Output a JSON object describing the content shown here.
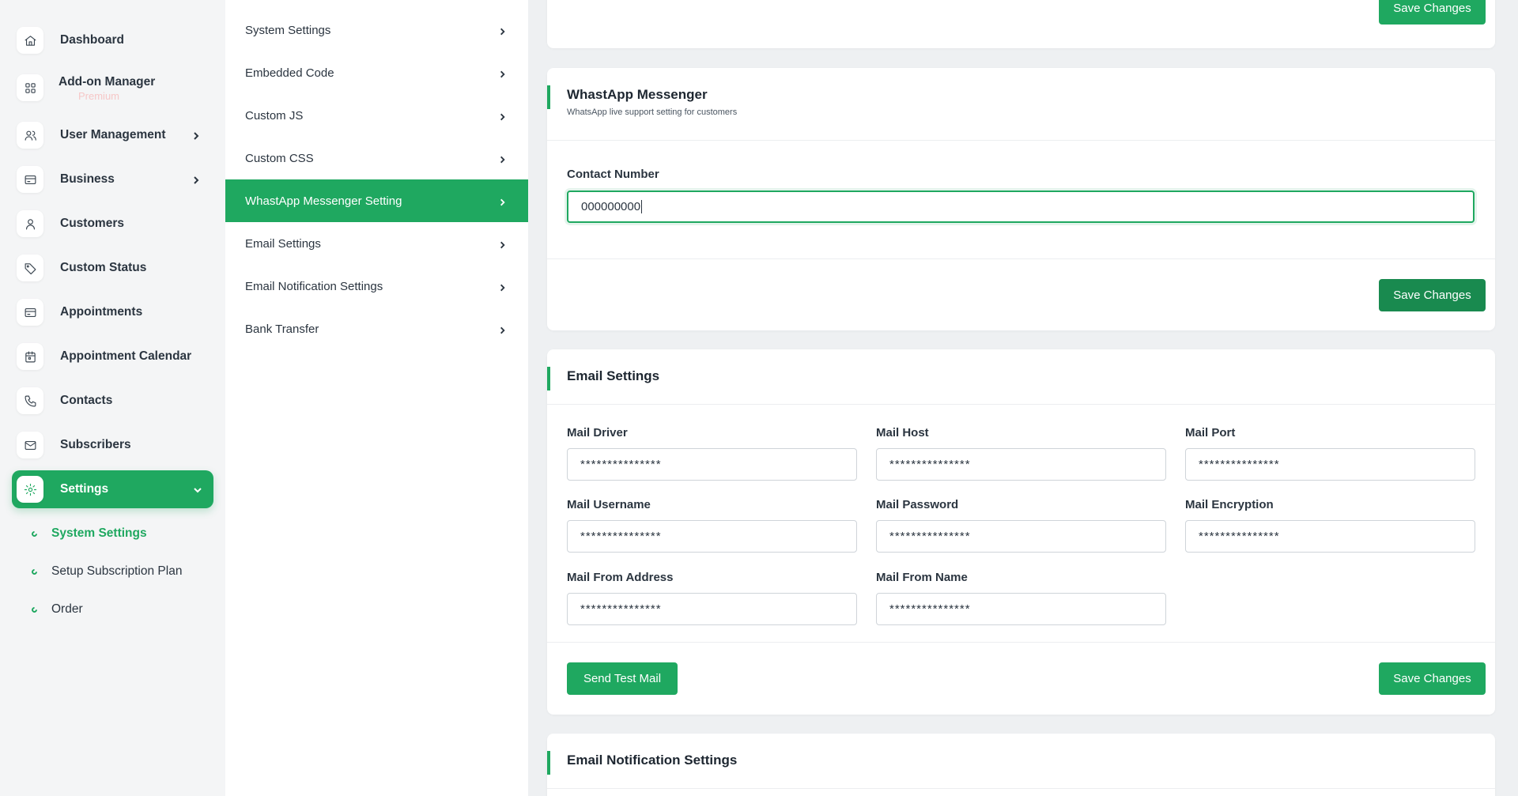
{
  "sidebar": {
    "items": [
      {
        "label": "Dashboard",
        "icon": "home-icon"
      },
      {
        "label": "Add-on Manager",
        "icon": "grid-icon",
        "badge": "Premium"
      },
      {
        "label": "User Management",
        "icon": "users-icon",
        "has_children": true
      },
      {
        "label": "Business",
        "icon": "card-icon",
        "has_children": true
      },
      {
        "label": "Customers",
        "icon": "user-icon"
      },
      {
        "label": "Custom Status",
        "icon": "tag-icon"
      },
      {
        "label": "Appointments",
        "icon": "card-icon"
      },
      {
        "label": "Appointment Calendar",
        "icon": "calendar-icon"
      },
      {
        "label": "Contacts",
        "icon": "phone-icon"
      },
      {
        "label": "Subscribers",
        "icon": "mail-icon"
      },
      {
        "label": "Settings",
        "icon": "gear-icon",
        "active": true,
        "expanded": true
      }
    ],
    "sub_items": [
      {
        "label": "System Settings",
        "active": true
      },
      {
        "label": "Setup Subscription Plan"
      },
      {
        "label": "Order"
      }
    ]
  },
  "settings_menu": {
    "items": [
      {
        "label": "System Settings"
      },
      {
        "label": "Embedded Code"
      },
      {
        "label": "Custom JS"
      },
      {
        "label": "Custom CSS"
      },
      {
        "label": "WhastApp Messenger Setting",
        "active": true
      },
      {
        "label": "Email Settings"
      },
      {
        "label": "Email Notification Settings"
      },
      {
        "label": "Bank Transfer"
      }
    ]
  },
  "top_card": {
    "save_label": "Save Changes"
  },
  "whatsapp": {
    "title": "WhastApp Messenger",
    "subtitle": "WhatsApp live support setting for customers",
    "contact_label": "Contact Number",
    "contact_value": "000000000",
    "save_label": "Save Changes"
  },
  "email": {
    "title": "Email Settings",
    "fields": [
      {
        "label": "Mail Driver",
        "value": "***************"
      },
      {
        "label": "Mail Host",
        "value": "***************"
      },
      {
        "label": "Mail Port",
        "value": "***************"
      },
      {
        "label": "Mail Username",
        "value": "***************"
      },
      {
        "label": "Mail Password",
        "value": "***************"
      },
      {
        "label": "Mail Encryption",
        "value": "***************"
      },
      {
        "label": "Mail From Address",
        "value": "***************"
      },
      {
        "label": "Mail From Name",
        "value": "***************"
      }
    ],
    "test_label": "Send Test Mail",
    "save_label": "Save Changes"
  },
  "email_notification": {
    "title": "Email Notification Settings"
  },
  "colors": {
    "accent": "#1fa860",
    "accent_dark": "#198a4f",
    "sidebar_bg": "#f4f5f6",
    "page_bg": "#eef0f2"
  }
}
